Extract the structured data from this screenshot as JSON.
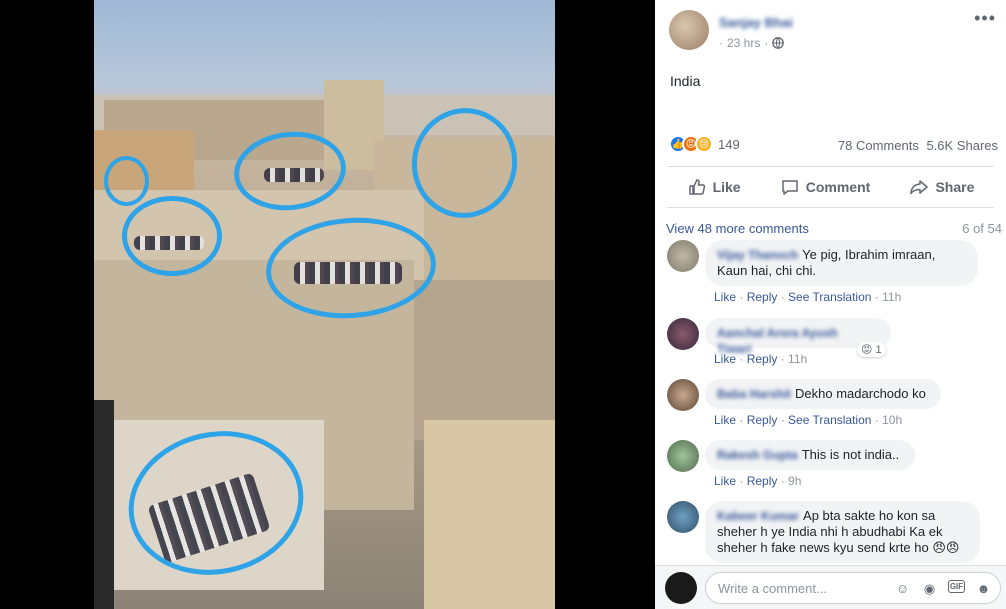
{
  "post": {
    "author": "Sanjay Bhai",
    "time": "23 hrs",
    "text": "India",
    "reaction_count": "149",
    "comments": "78 Comments",
    "shares": "5.6K Shares"
  },
  "actions": {
    "like": "Like",
    "comment": "Comment",
    "share": "Share"
  },
  "comments_header": {
    "view_more": "View 48 more comments",
    "page": "6 of 54"
  },
  "comments": [
    {
      "name": "Vijay Thanoch",
      "text": "Ye pig, Ibrahim imraan, Kaun hai, chi chi.",
      "like": "Like",
      "reply": "Reply",
      "translate": "See Translation",
      "time": "11h"
    },
    {
      "name": "Aanchal Arora Ayush Tiwari",
      "text": "",
      "like": "Like",
      "reply": "Reply",
      "time": "11h",
      "reaction_count": "1"
    },
    {
      "name": "Baba Harshit",
      "text": "Dekho madarchodo ko",
      "like": "Like",
      "reply": "Reply",
      "translate": "See Translation",
      "time": "10h"
    },
    {
      "name": "Rakesh Gupta",
      "text": "This is not india..",
      "like": "Like",
      "reply": "Reply",
      "time": "9h"
    },
    {
      "name": "Kabeer Kumar",
      "text": "Ap bta sakte ho kon sa sheher h ye India nhi h abudhabi Ka ek sheher h fake news kyu send krte ho",
      "emojis": "😠😠"
    }
  ],
  "composer": {
    "placeholder": "Write a comment..."
  },
  "icons": [
    "globe-icon",
    "more-icon",
    "like-icon",
    "comment-icon",
    "share-icon",
    "emoji-icon",
    "camera-icon",
    "gif-icon",
    "sticker-icon"
  ],
  "colors": {
    "link": "#385898",
    "like_blue": "#1877f2",
    "scribble": "#2ea3e8"
  }
}
